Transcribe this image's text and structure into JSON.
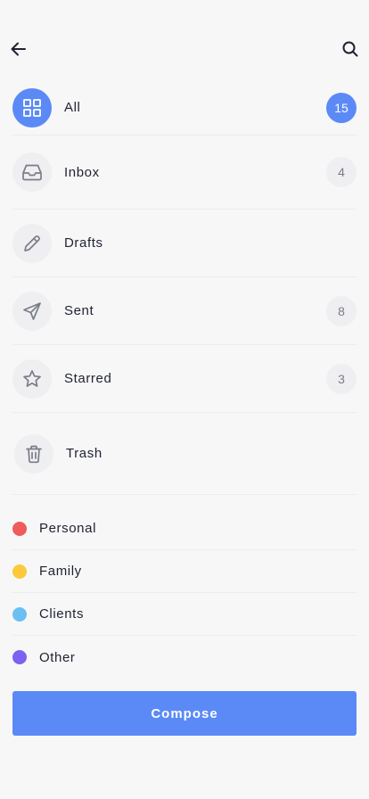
{
  "header": {
    "back_icon": "arrow-left-icon",
    "search_icon": "search-icon"
  },
  "folders": [
    {
      "label": "All",
      "icon": "grid-icon",
      "count": "15",
      "active": true
    },
    {
      "label": "Inbox",
      "icon": "inbox-tray-icon",
      "count": "4",
      "active": false
    },
    {
      "label": "Drafts",
      "icon": "pencil-icon",
      "count": "",
      "active": false
    },
    {
      "label": "Sent",
      "icon": "send-icon",
      "count": "8",
      "active": false
    },
    {
      "label": "Starred",
      "icon": "star-icon",
      "count": "3",
      "active": false
    },
    {
      "label": "Trash",
      "icon": "trash-icon",
      "count": "",
      "active": false
    }
  ],
  "labels": [
    {
      "label": "Personal",
      "color": "#ef5b5b"
    },
    {
      "label": "Family",
      "color": "#fcc93a"
    },
    {
      "label": "Clients",
      "color": "#6ac0f2"
    },
    {
      "label": "Other",
      "color": "#7d61ef"
    }
  ],
  "compose": {
    "label": "Compose"
  },
  "colors": {
    "accent": "#5b8af7",
    "icon_stroke": "#7a7d88",
    "background": "#f7f7f8"
  }
}
